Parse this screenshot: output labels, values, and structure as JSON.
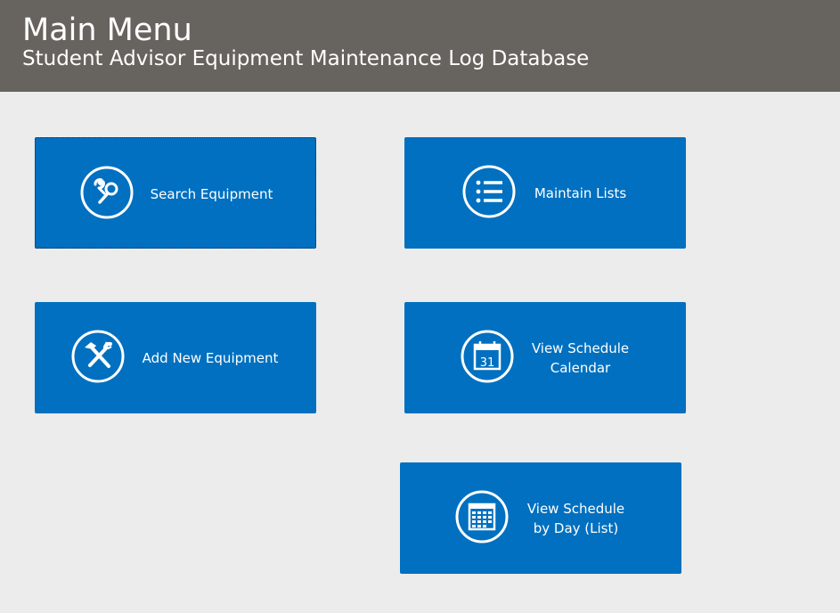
{
  "header": {
    "title": "Main Menu",
    "subtitle": "Student Advisor Equipment Maintenance Log Database"
  },
  "tiles": {
    "search_equipment": {
      "label": "Search Equipment",
      "icon": "wrench-search-icon"
    },
    "maintain_lists": {
      "label": "Maintain Lists",
      "icon": "list-icon"
    },
    "add_new_equipment": {
      "label": "Add New Equipment",
      "icon": "hammer-wrench-icon"
    },
    "view_schedule_calendar": {
      "label_line1": "View Schedule",
      "label_line2": "Calendar",
      "icon": "calendar-31-icon"
    },
    "view_schedule_day": {
      "label_line1": "View Schedule",
      "label_line2": "by Day (List)",
      "icon": "calendar-grid-icon"
    }
  },
  "colors": {
    "header_bg": "#67635e",
    "page_bg": "#ececec",
    "tile_bg": "#0170c0",
    "text": "#ffffff"
  }
}
